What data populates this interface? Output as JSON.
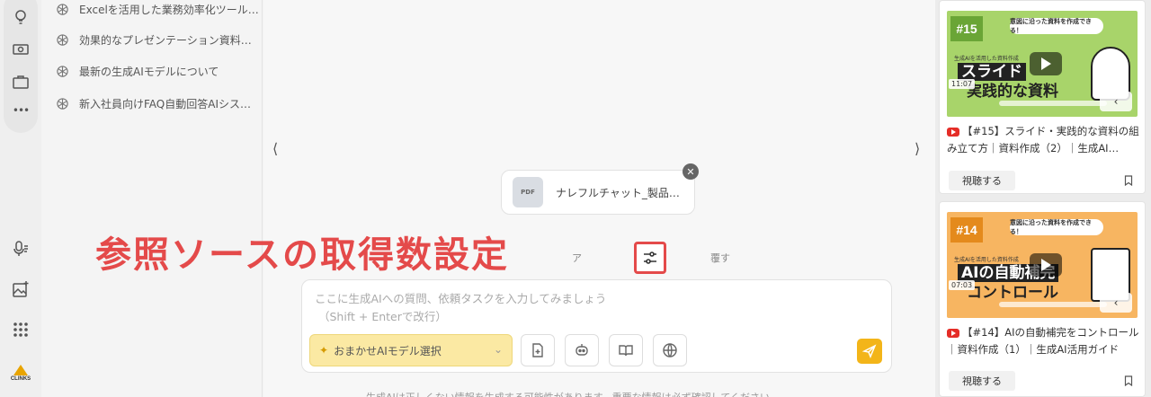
{
  "history": {
    "items": [
      {
        "label": "Excelを活用した業務効率化ツール…"
      },
      {
        "label": "効果的なプレゼンテーション資料…"
      },
      {
        "label": "最新の生成AIモデルについて"
      },
      {
        "label": "新入社員向けFAQ自動回答AIシス…"
      }
    ]
  },
  "rail": {
    "icons": [
      "lightbulb-icon",
      "money-icon",
      "briefcase-icon",
      "more-icon",
      "voice-icon",
      "image-ai-icon",
      "apps-grid-icon"
    ],
    "more_glyph": "•••",
    "logo_text": "CLINKS"
  },
  "main": {
    "nav_left": "⟨",
    "nav_right": "⟩",
    "file": {
      "icon_text": "PDF",
      "name": "ナレフルチャット_製品…",
      "close": "✕"
    },
    "annotation": "参照ソースの取得数設定",
    "hidden_label": "ア　　　　　　　　　　　　　覆す",
    "composer": {
      "placeholder_line1": "ここに生成AIへの質問、依頼タスクを入力してみましょう",
      "placeholder_line2": "（Shift + Enterで改行）",
      "model_select": "おまかせAIモデル選択",
      "spark": "✦",
      "dropdown": "⌄"
    },
    "disclaimer": "生成AIは正しくない情報を生成する可能性があります。重要な情報は必ず確認してください。"
  },
  "videos": [
    {
      "episode": "#15",
      "banner": "意図に沿った資料を作成できる！",
      "small": "生成AIを活用した資料作成",
      "big": "スライド",
      "big2": "実践的な資料",
      "duration": "11:07",
      "back": "‹",
      "title": "【#15】スライド・実践的な資料の組み立て方｜資料作成（2）｜生成AI…",
      "watch": "視聴する",
      "thumb_color": "#a8d46a",
      "ep_color": "#6aa536"
    },
    {
      "episode": "#14",
      "banner": "意図に沿った資料を作成できる！",
      "small": "生成AIを活用した資料作成",
      "big": "AIの自動補完",
      "big2": "コントロール",
      "duration": "07:03",
      "back": "‹",
      "title": "【#14】AIの自動補完をコントロール｜資料作成（1）｜生成AI活用ガイド",
      "watch": "視聴する",
      "thumb_color": "#f7b561",
      "ep_color": "#e48a1c"
    }
  ],
  "colors": {
    "accent": "#f3b519",
    "annotation": "#e44a4a",
    "model_bg": "#fbe9a3"
  }
}
